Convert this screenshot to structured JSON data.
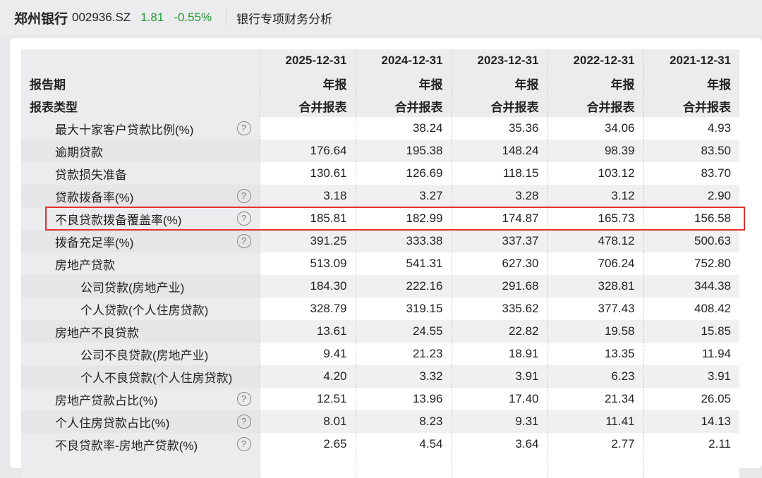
{
  "header": {
    "name": "郑州银行",
    "code": "002936.SZ",
    "price": "1.81",
    "change": "-0.55%",
    "section": "银行专项财务分析"
  },
  "table": {
    "header_labels": [
      "报告期",
      "报表类型"
    ],
    "columns": [
      {
        "date": "2025-12-31",
        "period": "年报",
        "type": "合并报表"
      },
      {
        "date": "2024-12-31",
        "period": "年报",
        "type": "合并报表"
      },
      {
        "date": "2023-12-31",
        "period": "年报",
        "type": "合并报表"
      },
      {
        "date": "2022-12-31",
        "period": "年报",
        "type": "合并报表"
      },
      {
        "date": "2021-12-31",
        "period": "年报",
        "type": "合并报表"
      }
    ],
    "rows": [
      {
        "label": "最大十家客户贷款比例(%)",
        "level": 1,
        "help": true,
        "values": [
          "",
          "38.24",
          "35.36",
          "34.06",
          "4.93"
        ]
      },
      {
        "label": "逾期贷款",
        "level": 1,
        "help": false,
        "values": [
          "176.64",
          "195.38",
          "148.24",
          "98.39",
          "83.50"
        ]
      },
      {
        "label": "贷款损失准备",
        "level": 1,
        "help": false,
        "values": [
          "130.61",
          "126.69",
          "118.15",
          "103.12",
          "83.70"
        ]
      },
      {
        "label": "贷款拨备率(%)",
        "level": 1,
        "help": true,
        "values": [
          "3.18",
          "3.27",
          "3.28",
          "3.12",
          "2.90"
        ]
      },
      {
        "label": "不良贷款拨备覆盖率(%)",
        "level": 1,
        "help": true,
        "highlighted": true,
        "values": [
          "185.81",
          "182.99",
          "174.87",
          "165.73",
          "156.58"
        ]
      },
      {
        "label": "拨备充足率(%)",
        "level": 1,
        "help": true,
        "values": [
          "391.25",
          "333.38",
          "337.37",
          "478.12",
          "500.63"
        ]
      },
      {
        "label": "房地产贷款",
        "level": 1,
        "help": false,
        "values": [
          "513.09",
          "541.31",
          "627.30",
          "706.24",
          "752.80"
        ]
      },
      {
        "label": "公司贷款(房地产业)",
        "level": 2,
        "help": false,
        "values": [
          "184.30",
          "222.16",
          "291.68",
          "328.81",
          "344.38"
        ]
      },
      {
        "label": "个人贷款(个人住房贷款)",
        "level": 2,
        "help": false,
        "values": [
          "328.79",
          "319.15",
          "335.62",
          "377.43",
          "408.42"
        ]
      },
      {
        "label": "房地产不良贷款",
        "level": 1,
        "help": false,
        "values": [
          "13.61",
          "24.55",
          "22.82",
          "19.58",
          "15.85"
        ]
      },
      {
        "label": "公司不良贷款(房地产业)",
        "level": 2,
        "help": false,
        "values": [
          "9.41",
          "21.23",
          "18.91",
          "13.35",
          "11.94"
        ]
      },
      {
        "label": "个人不良贷款(个人住房贷款)",
        "level": 2,
        "help": false,
        "values": [
          "4.20",
          "3.32",
          "3.91",
          "6.23",
          "3.91"
        ]
      },
      {
        "label": "房地产贷款占比(%)",
        "level": 1,
        "help": true,
        "values": [
          "12.51",
          "13.96",
          "17.40",
          "21.34",
          "26.05"
        ]
      },
      {
        "label": "个人住房贷款占比(%)",
        "level": 1,
        "help": true,
        "values": [
          "8.01",
          "8.23",
          "9.31",
          "11.41",
          "14.13"
        ]
      },
      {
        "label": "不良贷款率-房地产贷款(%)",
        "level": 1,
        "help": true,
        "values": [
          "2.65",
          "4.54",
          "3.64",
          "2.77",
          "2.11"
        ]
      }
    ]
  },
  "help_glyph": "?"
}
